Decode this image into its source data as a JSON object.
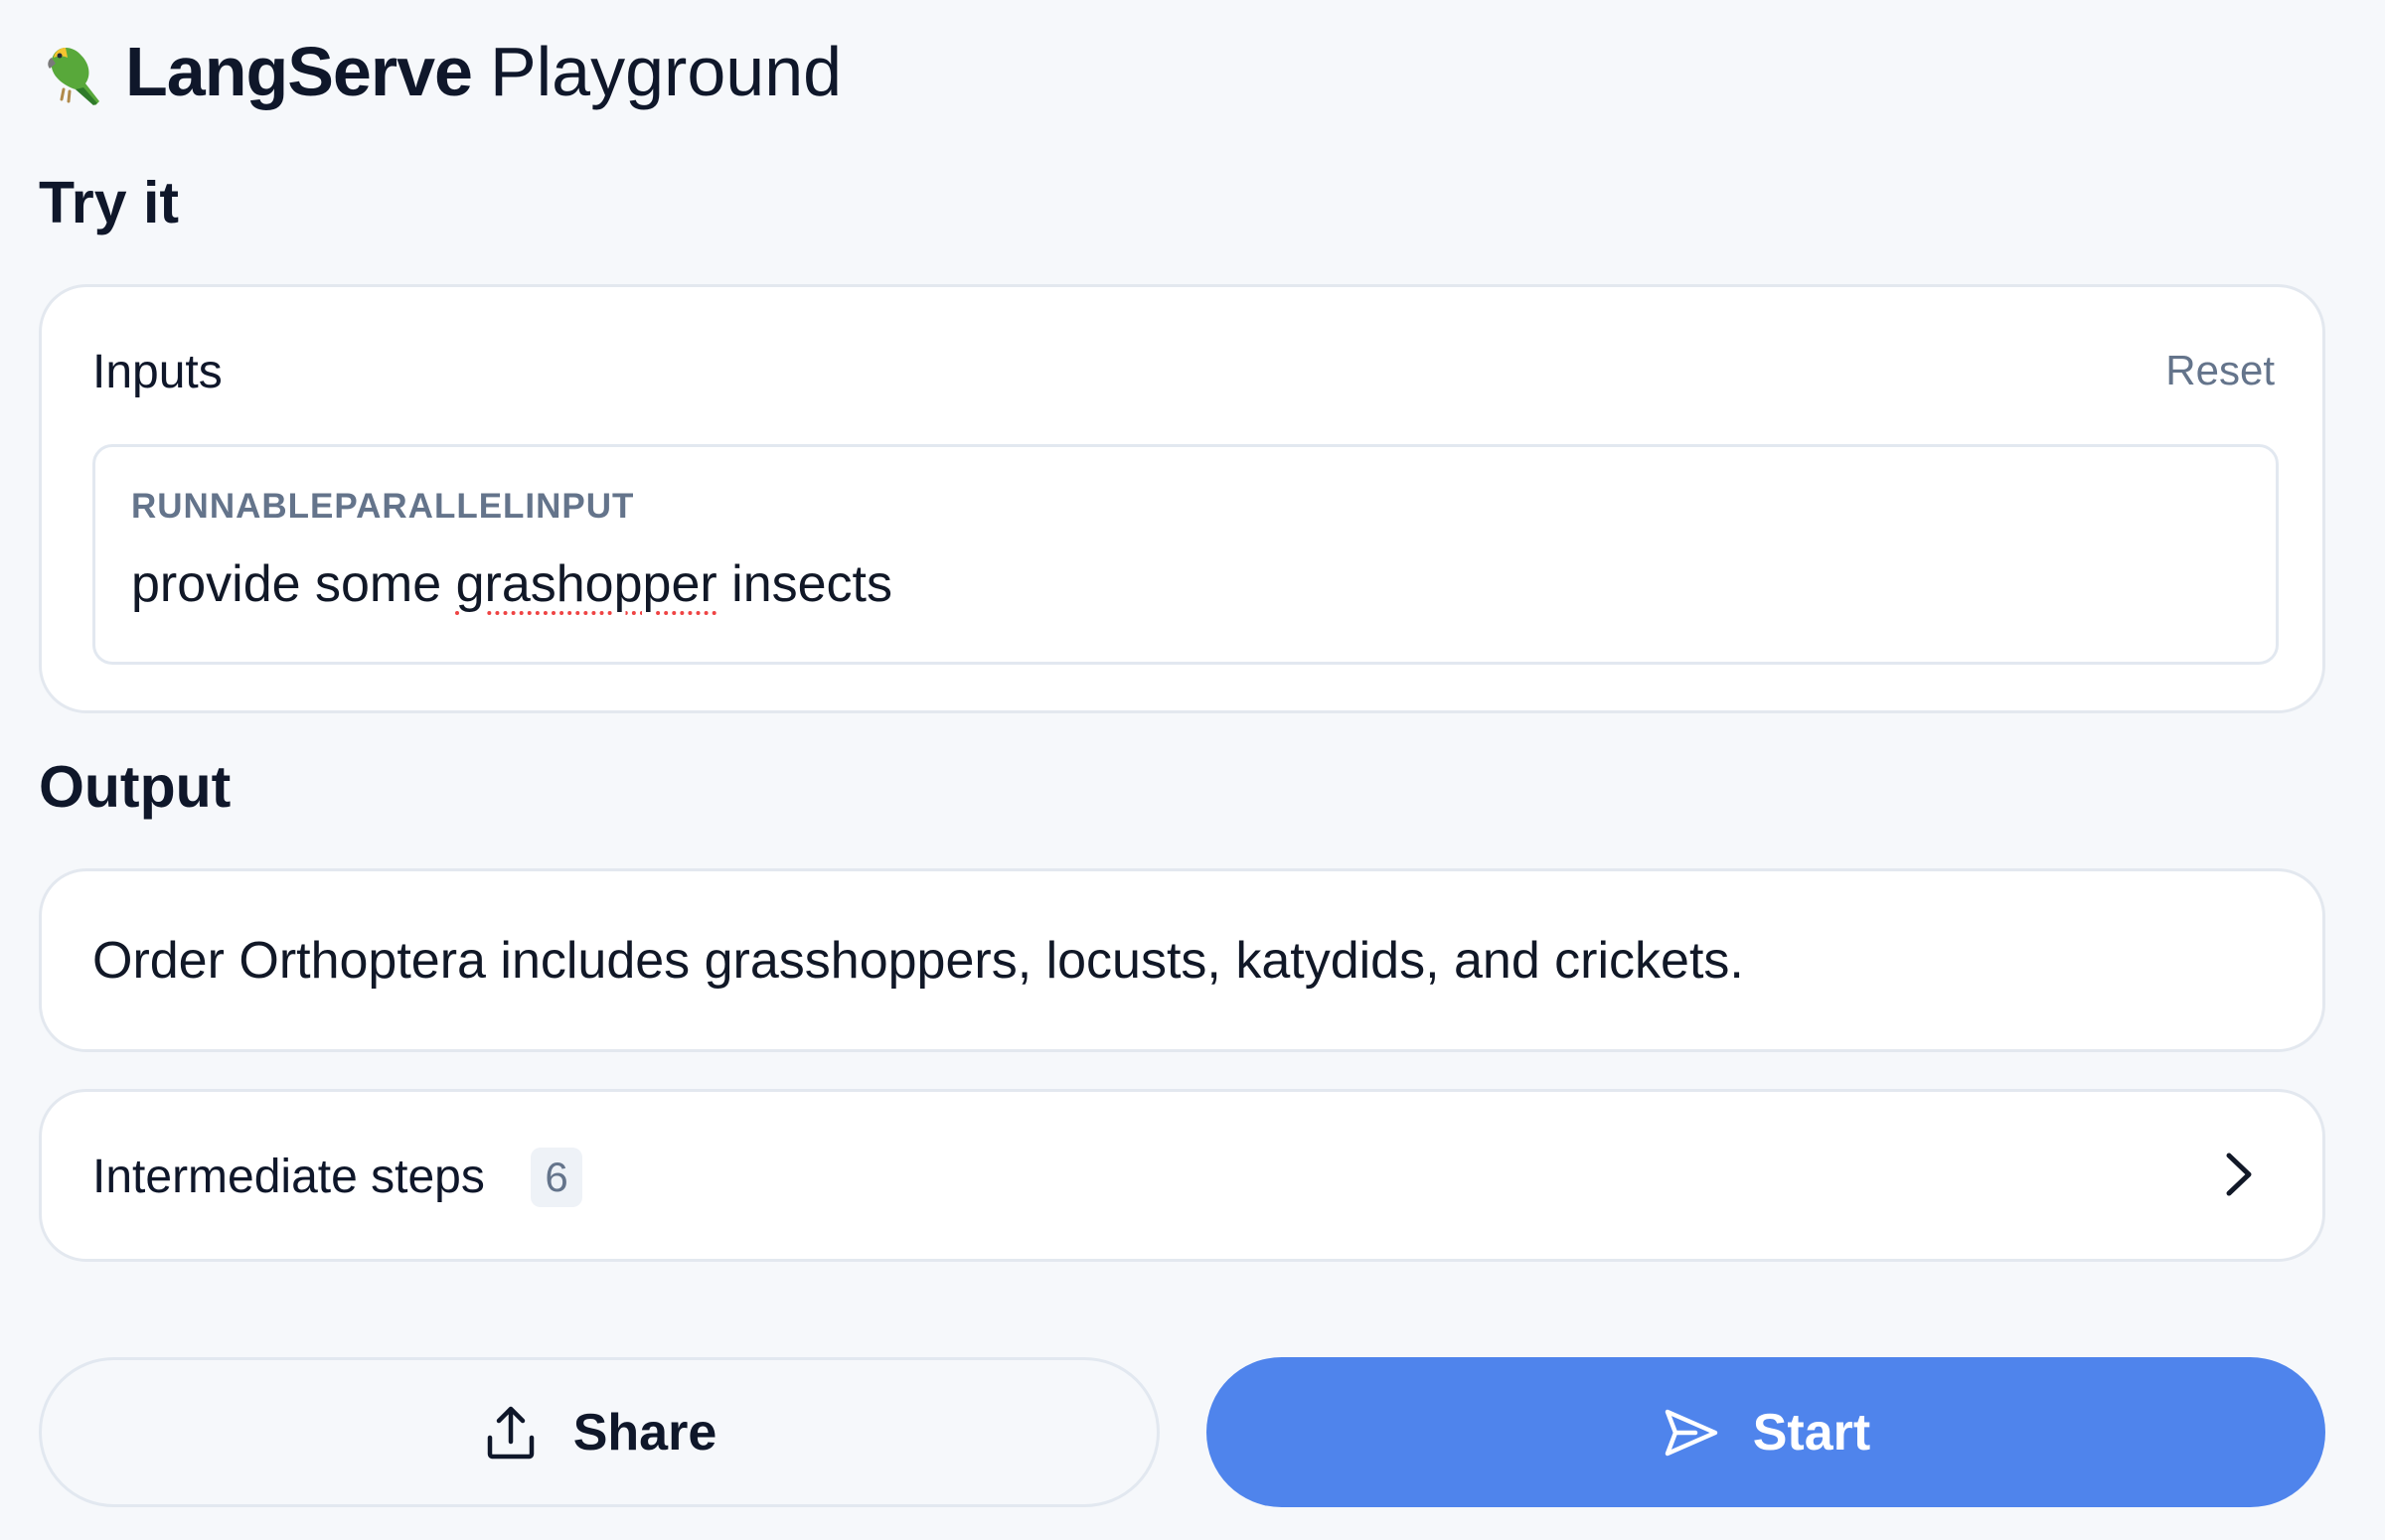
{
  "header": {
    "brand": "LangServe",
    "title": "Playground",
    "logo_icon": "parrot-icon"
  },
  "try_it": {
    "heading": "Try it",
    "inputs_label": "Inputs",
    "reset_label": "Reset",
    "field": {
      "label": "RUNNABLEPARALLELINPUT",
      "value_before": "provide some ",
      "value_misspelled": "grashopper",
      "value_after": " insects"
    }
  },
  "output": {
    "heading": "Output",
    "text": "Order Orthoptera includes grasshoppers, locusts, katydids, and crickets."
  },
  "intermediate_steps": {
    "label": "Intermediate steps",
    "count": "6",
    "icon": "chevron-right-icon"
  },
  "actions": {
    "share_label": "Share",
    "share_icon": "share-icon",
    "start_label": "Start",
    "start_icon": "send-icon"
  },
  "colors": {
    "background": "#f6f8fb",
    "accent": "#4f84ec",
    "card_border": "#e3e8ef",
    "muted_text": "#64748b"
  }
}
